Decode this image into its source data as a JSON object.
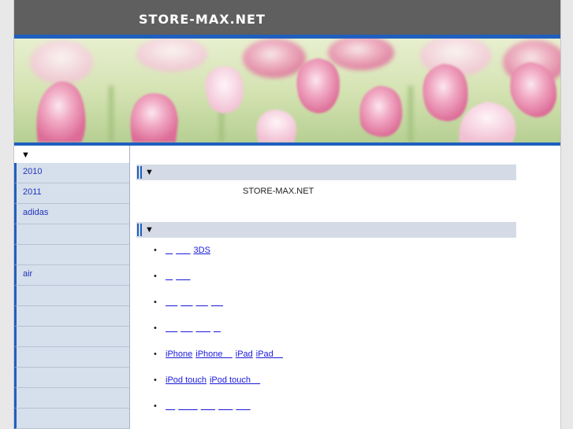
{
  "header": {
    "site_title": "STORE-MAX.NET"
  },
  "sidebar": {
    "heading": "▼",
    "items": [
      {
        "label": "2010"
      },
      {
        "label": "2011"
      },
      {
        "label": "adidas"
      },
      {
        "label": ""
      },
      {
        "label": ""
      },
      {
        "label": "air"
      },
      {
        "label": ""
      },
      {
        "label": ""
      },
      {
        "label": ""
      },
      {
        "label": ""
      },
      {
        "label": ""
      },
      {
        "label": ""
      },
      {
        "label": ""
      }
    ]
  },
  "main": {
    "section1": {
      "heading": "▼",
      "intro": "STORE-MAX.NET"
    },
    "section2": {
      "heading": "▼",
      "links": [
        [
          "   ",
          "      ",
          "3DS"
        ],
        [
          "   ",
          "      "
        ],
        [
          "     ",
          "     ",
          "     ",
          "     "
        ],
        [
          "     ",
          "     ",
          "      ",
          "   "
        ],
        [
          "iPhone",
          "iPhone    ",
          "iPad",
          "iPad    "
        ],
        [
          "iPod touch",
          "iPod touch    "
        ],
        [
          "    ",
          "        ",
          "      ",
          "      ",
          "      "
        ]
      ]
    }
  }
}
